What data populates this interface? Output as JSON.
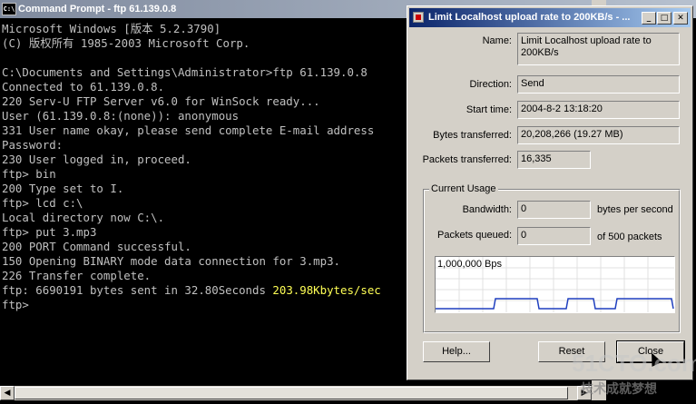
{
  "cmd": {
    "title": "Command Prompt - ftp 61.139.0.8",
    "icon": "cmd-icon",
    "icon_text": "C:\\",
    "lines": [
      {
        "text": "Microsoft Windows [版本 5.2.3790]",
        "hl": ""
      },
      {
        "text": "(C) 版权所有 1985-2003 Microsoft Corp.",
        "hl": ""
      },
      {
        "text": "",
        "hl": ""
      },
      {
        "text": "C:\\Documents and Settings\\Administrator>ftp 61.139.0.8",
        "hl": ""
      },
      {
        "text": "Connected to 61.139.0.8.",
        "hl": ""
      },
      {
        "text": "220 Serv-U FTP Server v6.0 for WinSock ready...",
        "hl": ""
      },
      {
        "text": "User (61.139.0.8:(none)): anonymous",
        "hl": ""
      },
      {
        "text": "331 User name okay, please send complete E-mail address",
        "hl": ""
      },
      {
        "text": "Password:",
        "hl": ""
      },
      {
        "text": "230 User logged in, proceed.",
        "hl": ""
      },
      {
        "text": "ftp> bin",
        "hl": ""
      },
      {
        "text": "200 Type set to I.",
        "hl": ""
      },
      {
        "text": "ftp> lcd c:\\",
        "hl": ""
      },
      {
        "text": "Local directory now C:\\.",
        "hl": ""
      },
      {
        "text": "ftp> put 3.mp3",
        "hl": ""
      },
      {
        "text": "200 PORT Command successful.",
        "hl": ""
      },
      {
        "text": "150 Opening BINARY mode data connection for 3.mp3.",
        "hl": ""
      },
      {
        "text": "226 Transfer complete.",
        "hl": ""
      },
      {
        "text": "ftp: 6690191 bytes sent in 32.80Seconds ",
        "hl": "203.98Kbytes/sec"
      },
      {
        "text": "ftp>",
        "hl": ""
      }
    ],
    "scroll_left": "◀",
    "scroll_right": "▶"
  },
  "dialog": {
    "title": "Limit Localhost upload rate to 200KB/s - ...",
    "buttons": {
      "minimize": "_",
      "maximize": "□",
      "close": "✕"
    },
    "fields": {
      "name_label": "Name:",
      "name_value": "Limit Localhost upload rate to 200KB/s",
      "direction_label": "Direction:",
      "direction_value": "Send",
      "start_label": "Start time:",
      "start_value": "2004-8-2 13:18:20",
      "bytes_label": "Bytes transferred:",
      "bytes_value": "20,208,266 (19.27 MB)",
      "packets_label": "Packets transferred:",
      "packets_value": "16,335"
    },
    "usage": {
      "group_label": "Current Usage",
      "bandwidth_label": "Bandwidth:",
      "bandwidth_value": "0",
      "bandwidth_unit": "bytes per second",
      "queued_label": "Packets queued:",
      "queued_value": "0",
      "queued_unit": "of 500 packets",
      "graph_label": "1,000,000 Bps"
    },
    "actions": {
      "help": "Help...",
      "reset": "Reset",
      "close": "Close"
    }
  },
  "watermark": {
    "brand": "51CTO.com",
    "slogan": "技术成就梦想"
  },
  "colors": {
    "console_bg": "#000000",
    "console_text": "#c0c0c0",
    "highlight": "#ffff55",
    "dialog_title": "#0a246a",
    "graph_line": "#1f3fbf"
  }
}
